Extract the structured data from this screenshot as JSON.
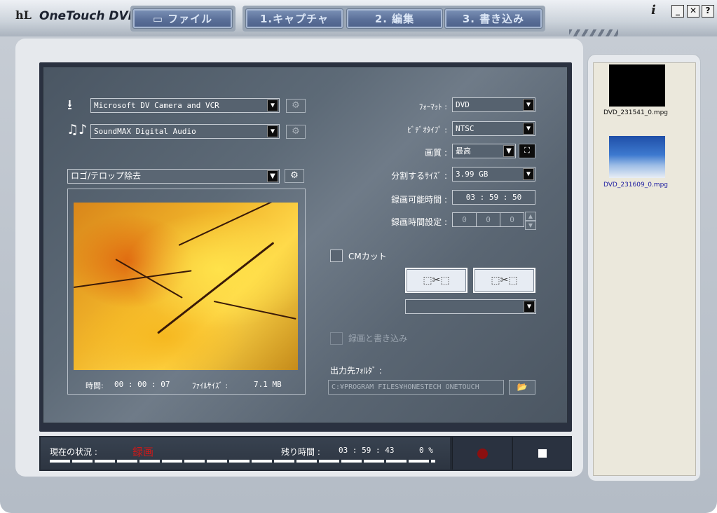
{
  "app": {
    "logo": "hL",
    "title": "OneTouch DVD"
  },
  "tabs": {
    "file": "ファイル",
    "capture": "1.キャプチャ",
    "edit": "2. 編集",
    "burn": "3. 書き込み"
  },
  "window_controls": {
    "info": "i",
    "minimize": "_",
    "maximize": "□",
    "help": "?"
  },
  "sources": {
    "video_device": "Microsoft DV Camera and VCR",
    "audio_device": "SoundMAX Digital Audio",
    "filter": "ロゴ/テロップ除去"
  },
  "preview": {
    "time_label": "時間:",
    "time_value": "00 : 00 : 07",
    "size_label": "ﾌｧｲﾙｻｲｽﾞ :",
    "size_value": "7.1 MB"
  },
  "settings": {
    "format_label": "ﾌｫｰﾏｯﾄ :",
    "format_value": "DVD",
    "video_type_label": "ﾋﾞﾃﾞｵﾀｲﾌﾟ :",
    "video_type_value": "NTSC",
    "quality_label": "画質 :",
    "quality_value": "最高",
    "split_size_label": "分割するｻｲｽﾞ :",
    "split_size_value": "3.99 GB",
    "recordable_time_label": "録画可能時間 :",
    "recordable_time_value": "03 : 59 : 50",
    "record_time_set_label": "録画時間設定 :",
    "record_time_set_hours": "0",
    "record_time_set_minutes": "0",
    "record_time_set_seconds": "0"
  },
  "cm_cut": {
    "label": "CMカット",
    "checked": false
  },
  "record_and_burn": {
    "label": "録画と書き込み",
    "enabled": false
  },
  "output": {
    "label": "出力先ﾌｫﾙﾀﾞ :",
    "path": "C:¥PROGRAM FILES¥HONESTECH ONETOUCH"
  },
  "status": {
    "label": "現在の状況 :",
    "value": "録画",
    "remaining_label": "残り時間 :",
    "remaining_value": "03 : 59 : 43",
    "percent": "0 %"
  },
  "files": [
    {
      "name": "DVD_231541_0.mpg",
      "selected": false
    },
    {
      "name": "DVD_231609_0.mpg",
      "selected": true
    }
  ],
  "icons": {
    "logo": "hl-logo-icon",
    "file_tab": "folder-icon",
    "capture_device": "download-arrow-icon",
    "audio_device": "music-notes-icon",
    "settings": "gear-icon",
    "fullscreen": "fullscreen-icon",
    "cut_in": "scissors-icon",
    "folder_browse": "open-folder-icon",
    "record": "record-icon",
    "stop": "stop-icon"
  },
  "colors": {
    "panel_bg": "#5d6a77",
    "status_text": "#d01818",
    "tab_bg": "#5b7099",
    "selected_file": "#1a1aa0"
  }
}
